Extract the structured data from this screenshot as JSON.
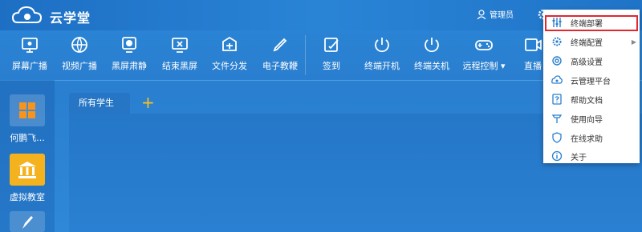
{
  "app": {
    "title": "云学堂"
  },
  "header": {
    "user_label": "管理员"
  },
  "toolbar": {
    "items": [
      {
        "label": "屏幕广播",
        "icon": "screen-broadcast-icon"
      },
      {
        "label": "视频广播",
        "icon": "video-broadcast-icon"
      },
      {
        "label": "黑屏肃静",
        "icon": "black-screen-icon"
      },
      {
        "label": "结束黑屏",
        "icon": "end-black-screen-icon"
      },
      {
        "label": "文件分发",
        "icon": "file-distribute-icon"
      },
      {
        "label": "电子教鞭",
        "icon": "pen-icon"
      },
      {
        "label": "签到",
        "icon": "sign-in-icon"
      },
      {
        "label": "终端开机",
        "icon": "power-on-icon"
      },
      {
        "label": "终端关机",
        "icon": "power-off-icon"
      },
      {
        "label": "远程控制 ▾",
        "icon": "gamepad-icon"
      },
      {
        "label": "直播",
        "icon": "live-icon"
      }
    ]
  },
  "sidebar": {
    "items": [
      {
        "label": "何鹏飞...",
        "icon": "windows-icon"
      },
      {
        "label": "虚拟教室",
        "icon": "classroom-icon"
      },
      {
        "label": "",
        "icon": "brush-icon"
      }
    ]
  },
  "tabs": {
    "items": [
      {
        "label": "所有学生"
      }
    ],
    "add_label": "+"
  },
  "menu": {
    "items": [
      {
        "label": "终端部署",
        "icon": "sliders-icon"
      },
      {
        "label": "终端配置",
        "icon": "gear-icon",
        "submenu": "▶"
      },
      {
        "label": "高级设置",
        "icon": "settings-icon"
      },
      {
        "label": "云管理平台",
        "icon": "cloud-gear-icon"
      },
      {
        "label": "帮助文档",
        "icon": "help-doc-icon"
      },
      {
        "label": "使用向导",
        "icon": "guide-icon"
      },
      {
        "label": "在线求助",
        "icon": "shield-icon"
      },
      {
        "label": "关于",
        "icon": "info-icon"
      }
    ]
  },
  "colors": {
    "accent": "#2a7fd0",
    "highlight": "#e0282e",
    "add": "#ffc21a"
  }
}
